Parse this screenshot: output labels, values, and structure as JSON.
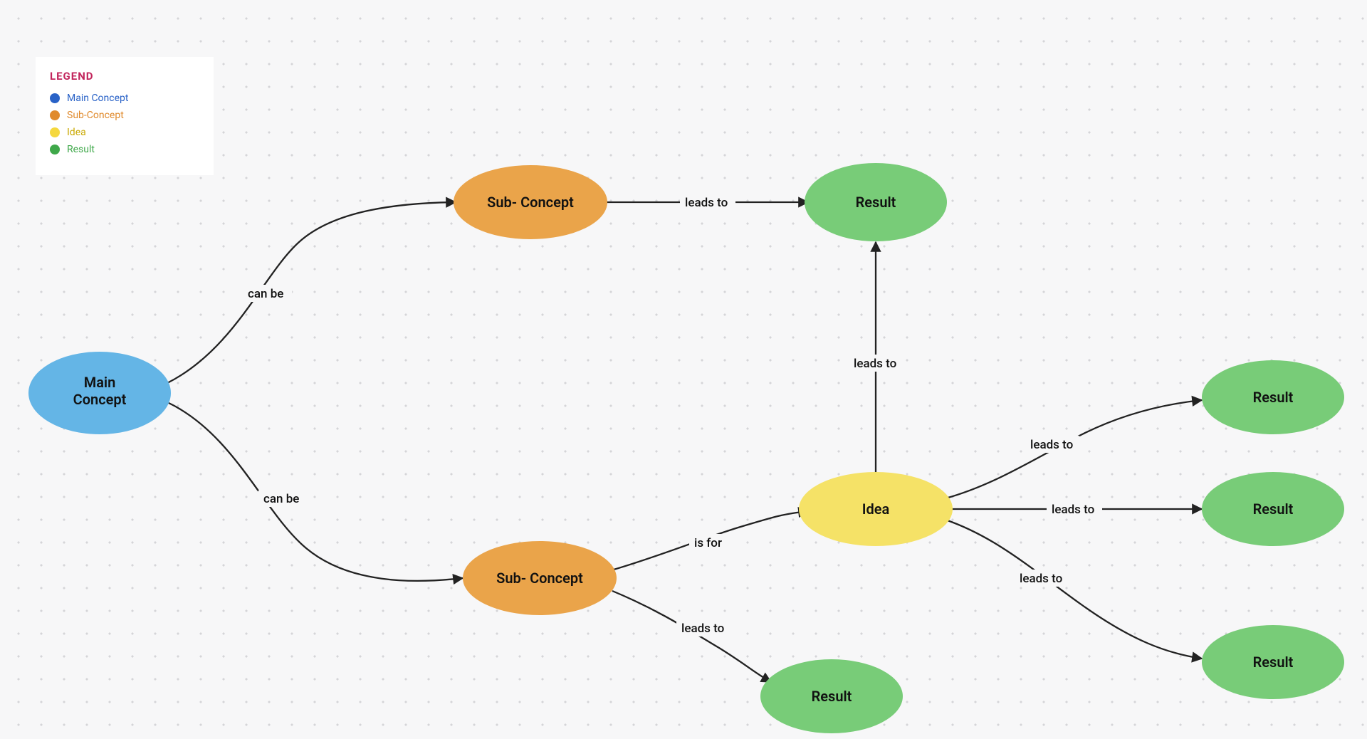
{
  "legend": {
    "title": "LEGEND",
    "items": [
      {
        "label": "Main Concept",
        "color": "#2962c7",
        "textColor": "#2962c7"
      },
      {
        "label": "Sub-Concept",
        "color": "#e08a2c",
        "textColor": "#e08a2c"
      },
      {
        "label": "Idea",
        "color": "#f5d83e",
        "textColor": "#c9a800"
      },
      {
        "label": "Result",
        "color": "#3fa84a",
        "textColor": "#3fa84a"
      }
    ]
  },
  "colors": {
    "mainConcept": "#64b5e6",
    "subConcept": "#eaa44a",
    "idea": "#f5e267",
    "result": "#78cc78"
  },
  "nodes": {
    "main": {
      "label1": "Main",
      "label2": "Concept"
    },
    "sub1": {
      "label": "Sub- Concept"
    },
    "sub2": {
      "label": "Sub- Concept"
    },
    "idea": {
      "label": "Idea"
    },
    "resultTop": {
      "label": "Result"
    },
    "resultMid": {
      "label": "Result"
    },
    "resultR1": {
      "label": "Result"
    },
    "resultR2": {
      "label": "Result"
    },
    "resultR3": {
      "label": "Result"
    }
  },
  "edgeLabels": {
    "main_sub1": "can be",
    "main_sub2": "can be",
    "sub1_resultTop": "leads to",
    "sub2_idea": "is for",
    "sub2_resultMid": "leads to",
    "idea_resultTop": "leads to",
    "idea_r1": "leads to",
    "idea_r2": "leads to",
    "idea_r3": "leads to"
  }
}
